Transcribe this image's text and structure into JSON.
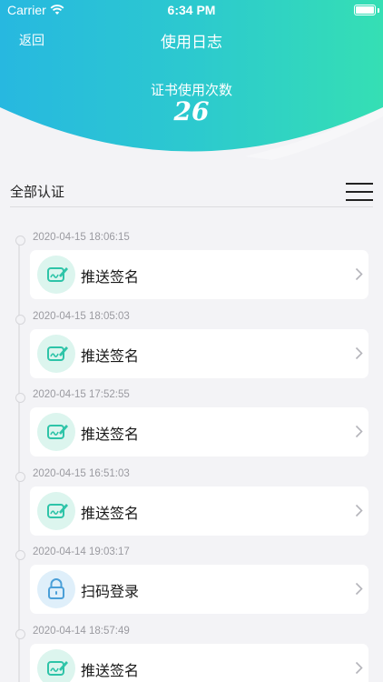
{
  "status_bar": {
    "carrier": "Carrier",
    "time": "6:34 PM"
  },
  "nav": {
    "back_label": "返回",
    "title": "使用日志"
  },
  "summary": {
    "label": "证书使用次数",
    "count": "26"
  },
  "filter": {
    "label": "全部认证"
  },
  "colors": {
    "header_start": "#27b8e0",
    "header_end": "#35dfb4",
    "sign_icon": "#2ec4a8",
    "lock_icon": "#4a9fd8"
  },
  "log_entries": [
    {
      "timestamp": "2020-04-15 18:06:15",
      "action": "推送签名",
      "icon": "signature-icon"
    },
    {
      "timestamp": "2020-04-15 18:05:03",
      "action": "推送签名",
      "icon": "signature-icon"
    },
    {
      "timestamp": "2020-04-15 17:52:55",
      "action": "推送签名",
      "icon": "signature-icon"
    },
    {
      "timestamp": "2020-04-15 16:51:03",
      "action": "推送签名",
      "icon": "signature-icon"
    },
    {
      "timestamp": "2020-04-14 19:03:17",
      "action": "扫码登录",
      "icon": "lock-icon"
    },
    {
      "timestamp": "2020-04-14 18:57:49",
      "action": "推送签名",
      "icon": "signature-icon"
    }
  ]
}
